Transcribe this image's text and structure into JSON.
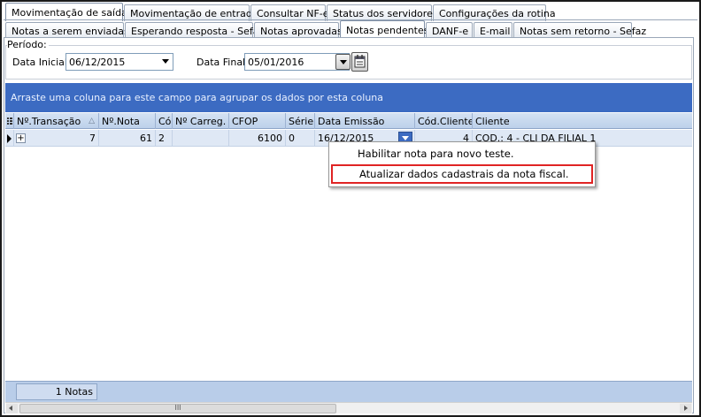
{
  "tabs_row1": [
    {
      "label": "Movimentação de saída",
      "active": true
    },
    {
      "label": "Movimentação de entrada",
      "active": false
    },
    {
      "label": "Consultar NF-e",
      "active": false
    },
    {
      "label": "Status dos servidores",
      "active": false
    },
    {
      "label": "Configurações da rotina",
      "active": false
    }
  ],
  "tabs_row2": [
    {
      "label": "Notas a serem enviadas",
      "active": false
    },
    {
      "label": "Esperando resposta - Sefaz",
      "active": false
    },
    {
      "label": "Notas aprovadas",
      "active": false
    },
    {
      "label": "Notas pendentes",
      "active": true
    },
    {
      "label": "DANF-e",
      "active": false
    },
    {
      "label": "E-mail",
      "active": false
    },
    {
      "label": "Notas sem retorno - Sefaz",
      "active": false
    }
  ],
  "period": {
    "label": "Período:",
    "start_label": "Data Inicial",
    "start_value": "06/12/2015",
    "end_label": "Data Final",
    "end_value": "05/01/2016"
  },
  "group_bar": "Arraste uma coluna para este campo para agrupar os dados por esta coluna",
  "grid": {
    "columns": [
      "Nº.Transação",
      "Nº.Nota",
      "Cód",
      "Nº Carreg.",
      "CFOP",
      "Série",
      "Data Emissão",
      "Cód.Cliente",
      "Cliente"
    ],
    "rows": [
      {
        "transacao": "7",
        "nota": "61",
        "cod": "2",
        "carreg": "",
        "cfop": "6100",
        "serie": "0",
        "emissao": "16/12/2015",
        "cod_cliente": "4",
        "cliente": "COD.: 4 - CLI DA FILIAL 1"
      }
    ]
  },
  "context_menu": {
    "items": [
      "Habilitar nota para novo teste.",
      "Atualizar dados cadastrais da nota fiscal."
    ]
  },
  "footer": {
    "count": "1 Notas",
    "scroll_grip": "III"
  },
  "colors": {
    "group_bar": "#3c6bc2",
    "header": "#c7d8ee",
    "highlight_border": "#e02424"
  }
}
